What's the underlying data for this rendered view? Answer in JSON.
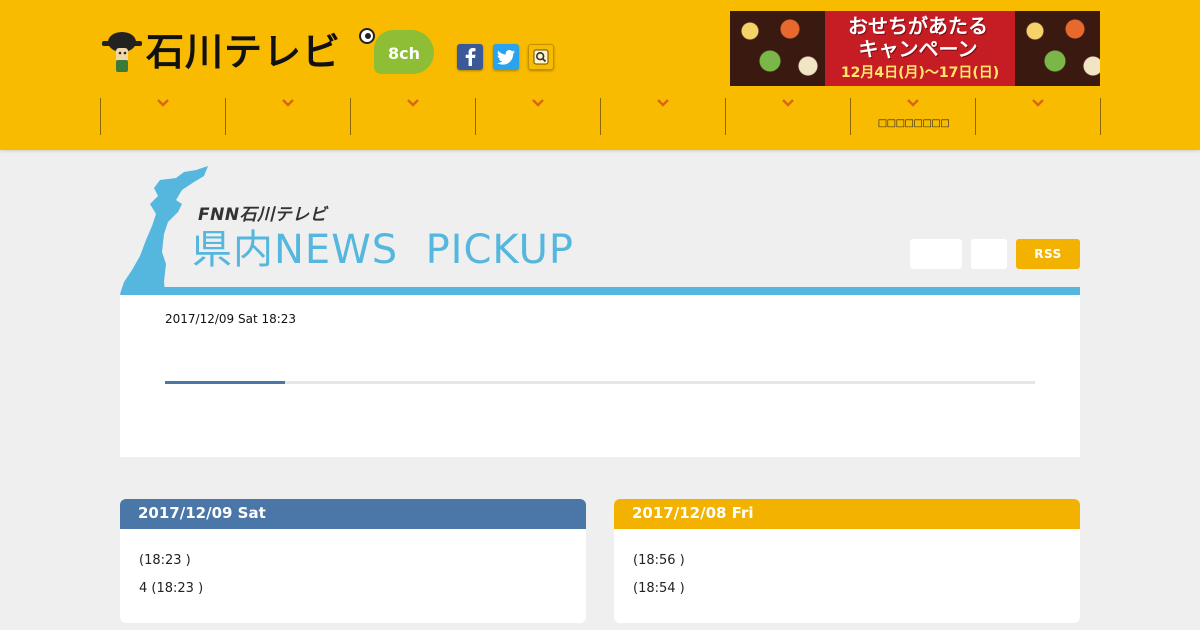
{
  "header": {
    "logo_text": "石川テレビ",
    "logo_channel": "8ch",
    "social": [
      {
        "icon": "facebook-icon",
        "color": "#3b5998"
      },
      {
        "icon": "twitter-icon",
        "color": "#2aa3ef"
      },
      {
        "icon": "search-icon",
        "color": "#f8bb00"
      }
    ],
    "banner": {
      "line1": "おせちがあたる",
      "line2": "キャンペーン",
      "line3": "12月4日(月)〜17日(日)"
    },
    "nav": [
      {
        "label": ""
      },
      {
        "label": ""
      },
      {
        "label": ""
      },
      {
        "label": ""
      },
      {
        "label": ""
      },
      {
        "label": ""
      },
      {
        "label": "□□□□□□□□"
      },
      {
        "label": ""
      }
    ],
    "background_color": "#f8bb00"
  },
  "pickup": {
    "brand": "FNN石川テレビ",
    "title": "県内NEWS  PICKUP",
    "rss_label": "RSS",
    "accent_color": "#55b7dd",
    "current_date": "2017/12/09 Sat 18:23",
    "progress_fraction": 0.138
  },
  "days": [
    {
      "date": "2017/12/09 Sat",
      "color": "#4a76a8",
      "items": [
        " (18:23 )",
        "4 (18:23 )"
      ]
    },
    {
      "date": "2017/12/08 Fri",
      "color": "#f4b200",
      "items": [
        "(18:56 )",
        "(18:54 )"
      ]
    }
  ]
}
